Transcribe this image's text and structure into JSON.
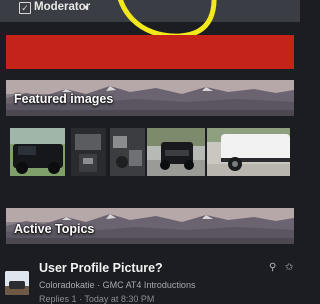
{
  "moderator": {
    "label": "Moderator",
    "checkbox_glyph": "☑",
    "caret_glyph": "▾",
    "checkbox_icon": "checkbox-icon",
    "caret_icon": "chevron-down-icon"
  },
  "annotation_color": "#f2e81b",
  "banner_color": "#c4231a",
  "featured": {
    "title": "Featured images",
    "images": [
      {
        "name": "black-truck-side-photo"
      },
      {
        "name": "interior-center-console-photo"
      },
      {
        "name": "engine-bay-photo"
      },
      {
        "name": "truck-front-driveway-photo"
      },
      {
        "name": "white-truck-side-step-photo"
      }
    ]
  },
  "active_topics": {
    "title": "Active Topics",
    "items": [
      {
        "title": "User Profile Picture?",
        "author": "Coloradokatie",
        "forum": "GMC AT4 Introductions",
        "meta_separator": "·",
        "sub_partial": "Replies 1 · Today at 8:30 PM",
        "pin_glyph": "⚲",
        "star_glyph": "✩"
      }
    ]
  }
}
